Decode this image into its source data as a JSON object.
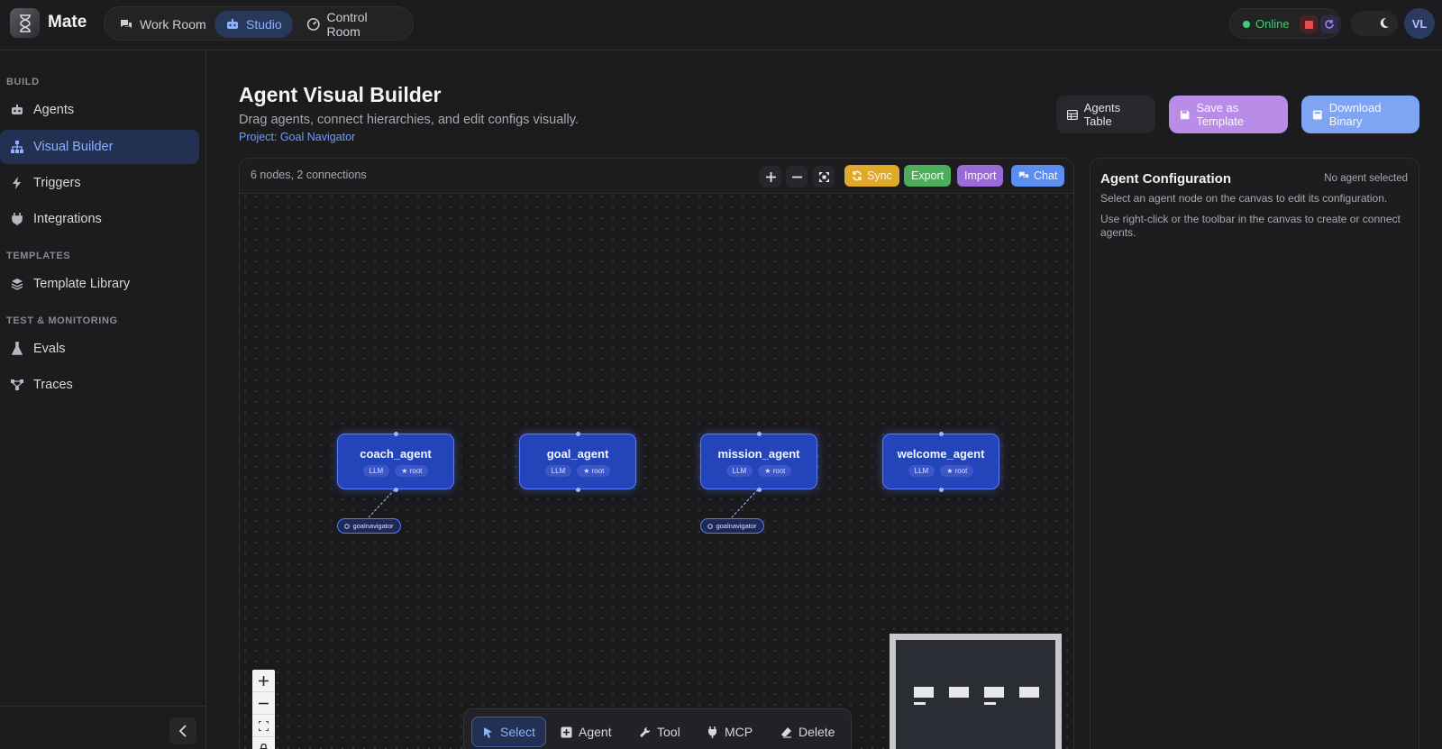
{
  "app": {
    "brand": "Mate",
    "nav": [
      {
        "label": "Work Room",
        "icon": "chat-icon",
        "active": false
      },
      {
        "label": "Studio",
        "icon": "robot-icon",
        "active": true
      },
      {
        "label": "Control Room",
        "icon": "dashboard-icon",
        "active": false
      }
    ],
    "status": {
      "label": "Online",
      "color": "#3ecf6e"
    },
    "avatar_initials": "VL"
  },
  "sidebar": {
    "sections": [
      {
        "label": "BUILD",
        "items": [
          {
            "label": "Agents",
            "icon": "robot-icon",
            "active": false
          },
          {
            "label": "Visual Builder",
            "icon": "sitemap-icon",
            "active": true
          },
          {
            "label": "Triggers",
            "icon": "bolt-icon",
            "active": false
          },
          {
            "label": "Integrations",
            "icon": "plug-icon",
            "active": false
          }
        ]
      },
      {
        "label": "TEMPLATES",
        "items": [
          {
            "label": "Template Library",
            "icon": "layers-icon",
            "active": false
          }
        ]
      },
      {
        "label": "TEST & MONITORING",
        "items": [
          {
            "label": "Evals",
            "icon": "flask-icon",
            "active": false
          },
          {
            "label": "Traces",
            "icon": "network-icon",
            "active": false
          }
        ]
      }
    ]
  },
  "header": {
    "title": "Agent Visual Builder",
    "subtitle": "Drag agents, connect hierarchies, and edit configs visually.",
    "project": "Project: Goal Navigator",
    "buttons": {
      "agents_table": "Agents Table",
      "save_template": "Save as Template",
      "download_binary": "Download Binary"
    }
  },
  "canvas": {
    "summary": "6 nodes, 2 connections",
    "toolbar": {
      "sync": "Sync",
      "export": "Export",
      "import": "Import",
      "chat": "Chat"
    },
    "nodes": [
      {
        "name": "coach_agent",
        "type": "LLM",
        "badge": "★ root",
        "tool": "goalnavigator"
      },
      {
        "name": "goal_agent",
        "type": "LLM",
        "badge": "★ root",
        "tool": ""
      },
      {
        "name": "mission_agent",
        "type": "LLM",
        "badge": "★ root",
        "tool": "goalnavigator"
      },
      {
        "name": "welcome_agent",
        "type": "LLM",
        "badge": "★ root",
        "tool": ""
      }
    ],
    "bottom_tools": {
      "select": "Select",
      "agent": "Agent",
      "tool": "Tool",
      "mcp": "MCP",
      "delete": "Delete"
    }
  },
  "config": {
    "title": "Agent Configuration",
    "state": "No agent selected",
    "hint1": "Select an agent node on the canvas to edit its configuration.",
    "hint2": "Use right-click or the toolbar in the canvas to create or connect agents."
  },
  "colors": {
    "accent": "#8fb0ff",
    "node": "#2444b9",
    "sync": "#e0a92a",
    "export": "#4cae5a",
    "import": "#9a6ad6",
    "chat": "#5b8ef0",
    "save_template": "#b98ce8",
    "download_binary": "#7fa4f2"
  }
}
